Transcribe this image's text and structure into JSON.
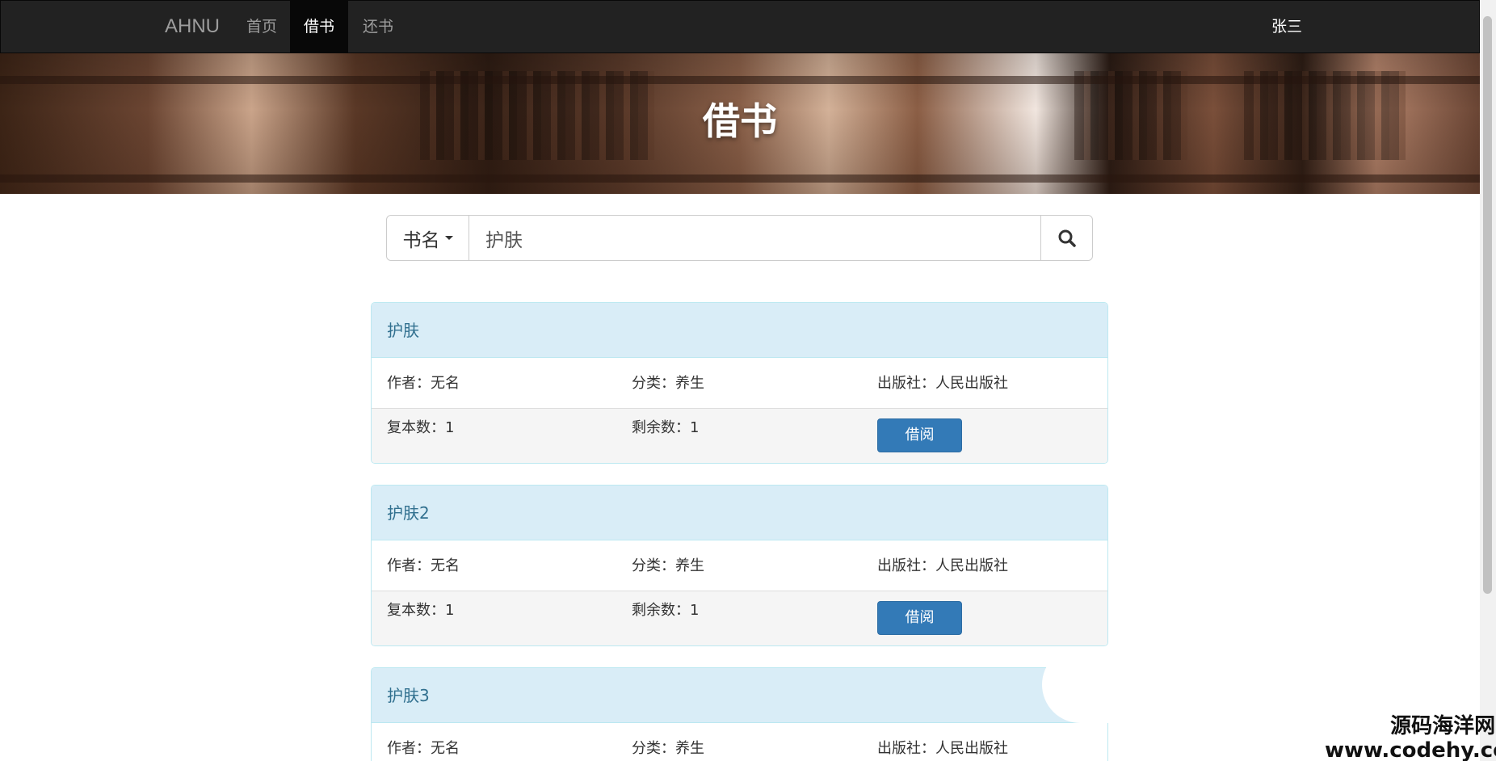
{
  "navbar": {
    "brand": "AHNU",
    "links": [
      {
        "label": "首页"
      },
      {
        "label": "借书"
      },
      {
        "label": "还书"
      }
    ],
    "user": "张三"
  },
  "banner": {
    "title": "借书"
  },
  "search": {
    "type_label": "书名",
    "query": "护肤",
    "icon": "search-icon"
  },
  "books": [
    {
      "title": "护肤",
      "author": "作者：无名",
      "category": "分类：养生",
      "publisher": "出版社：人民出版社",
      "copies": "复本数：1",
      "remaining": "剩余数：1",
      "button": "借阅"
    },
    {
      "title": "护肤2",
      "author": "作者：无名",
      "category": "分类：养生",
      "publisher": "出版社：人民出版社",
      "copies": "复本数：1",
      "remaining": "剩余数：1",
      "button": "借阅"
    },
    {
      "title": "护肤3",
      "author": "作者：无名",
      "category": "分类：养生",
      "publisher": "出版社：人民出版社"
    }
  ],
  "watermark": {
    "line1": "源码海洋网",
    "line2": "www.codehy.com"
  },
  "colors": {
    "navbar_bg": "#222222",
    "panel_heading_bg": "#d9edf7",
    "panel_heading_text": "#31708f",
    "primary_button": "#337ab7"
  }
}
